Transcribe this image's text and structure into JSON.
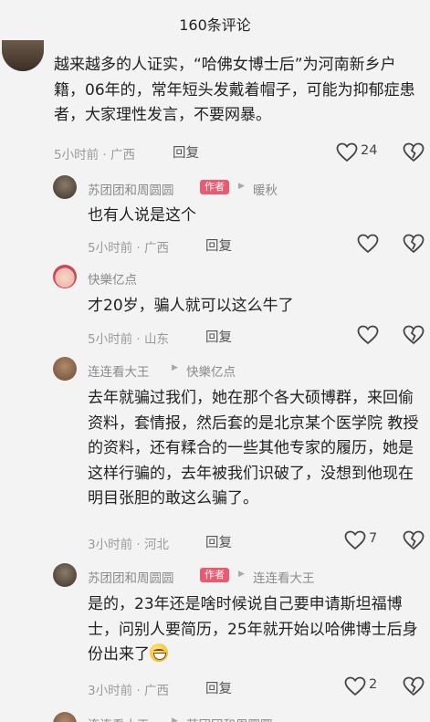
{
  "header": {
    "title": "160条评论"
  },
  "comments": [
    {
      "text": "越来越多的人证实，“哈佛女博士后”为河南新乡户籍，06年的，常年短头发戴着帽子，可能为抑郁症患者，大家理性发言，不要网暴。",
      "time": "5小时前 · 广西",
      "reply_label": "回复",
      "likes": "24"
    }
  ],
  "replies": [
    {
      "user": "苏团团和周圆圆",
      "badge": "作者",
      "reply_to": "暖秋",
      "text": "也有人说是这个",
      "time": "5小时前 · 广西",
      "reply_label": "回复"
    },
    {
      "user": "快樂亿点",
      "text": "才20岁，骗人就可以这么牛了",
      "time": "5小时前 · 山东",
      "reply_label": "回复"
    },
    {
      "user": "连连看大王",
      "reply_to": "快樂亿点",
      "text": "去年就骗过我们，她在那个各大硕博群，来回偷资料，套情报，然后套的是北京某个医学院 教授的资料，还有糅合的一些其他专家的履历，她是这样行骗的，去年被我们识破了，没想到他现在明目张胆的敢这么骗了。",
      "time": "3小时前 · 河北",
      "reply_label": "回复",
      "likes": "7"
    },
    {
      "user": "苏团团和周圆圆",
      "badge": "作者",
      "reply_to": "连连看大王",
      "text": "是的，23年还是啥时候说自己要申请斯坦福博士，问别人要简历，25年就开始以哈佛博士后身份出来了",
      "time": "3小时前 · 广西",
      "reply_label": "回复",
      "likes": "2"
    },
    {
      "user": "连连看大王",
      "reply_to": "苏团团和周圆圆"
    }
  ],
  "icons": {
    "like": "heart-outline-icon",
    "dislike": "broken-heart-icon",
    "reply_arrow": "triangle-right-icon"
  },
  "colors": {
    "badge": "#ec5a6f",
    "meta": "#9a9a9a",
    "background": "#f3f3f3"
  }
}
